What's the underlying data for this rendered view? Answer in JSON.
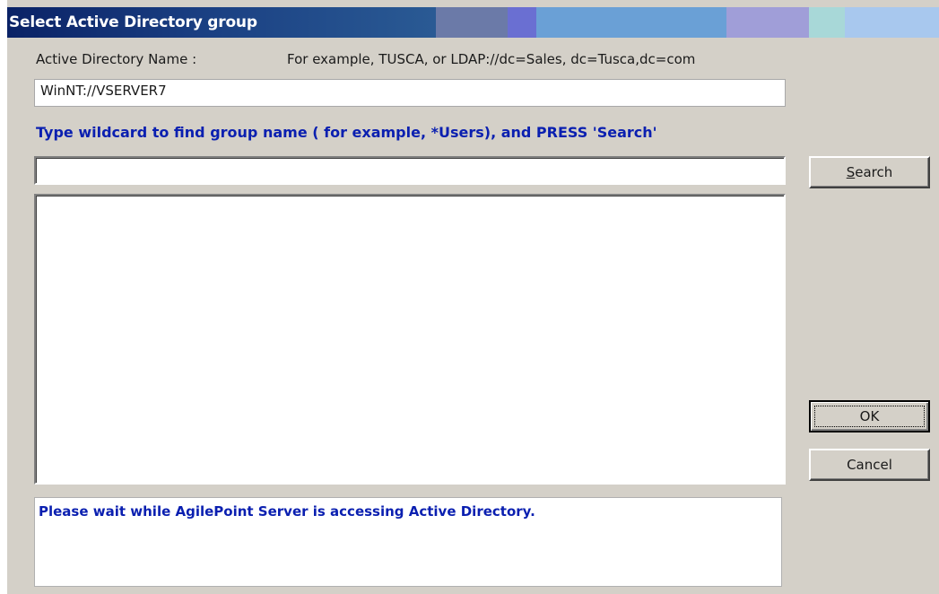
{
  "dialog": {
    "title": "Select Active Directory group"
  },
  "directory": {
    "label": "Active Directory Name :",
    "example": "For example, TUSCA, or LDAP://dc=Sales, dc=Tusca,dc=com",
    "value": "WinNT://VSERVER7"
  },
  "search": {
    "instruction": "Type wildcard to find group name ( for example, *Users), and PRESS 'Search'",
    "value": "",
    "button_mnemonic": "S",
    "button_rest": "earch"
  },
  "results": {
    "items": []
  },
  "buttons": {
    "ok": "OK",
    "cancel": "Cancel"
  },
  "status": {
    "message": "Please wait while AgilePoint Server is accessing Active Directory."
  },
  "colors": {
    "title_text": "#ffffff",
    "title_base": "#0c246a",
    "dialog_bg": "#d4d0c8",
    "instruction_blue": "#0a1fb0"
  }
}
